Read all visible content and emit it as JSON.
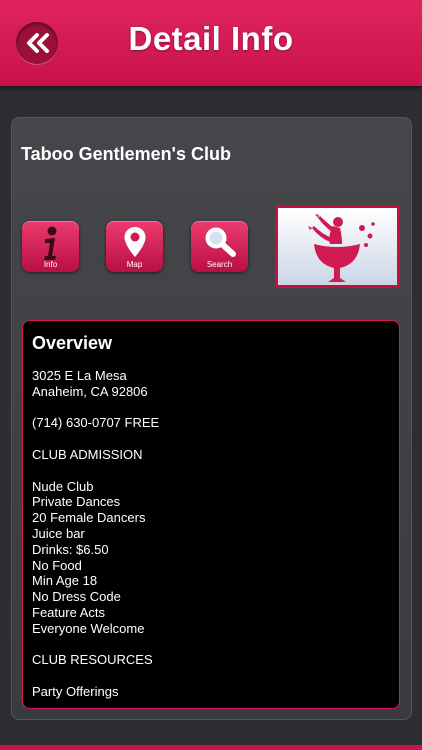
{
  "header": {
    "title": "Detail Info",
    "back_icon": "double-chevron-left-icon"
  },
  "club": {
    "name": "Taboo Gentlemen's Club"
  },
  "actions": [
    {
      "label": "Info",
      "icon": "info-icon"
    },
    {
      "label": "Map",
      "icon": "map-pin-icon"
    },
    {
      "label": "Search",
      "icon": "magnifier-icon"
    }
  ],
  "thumbnail": {
    "icon": "woman-in-wineglass-logo"
  },
  "overview": {
    "heading": "Overview",
    "lines": [
      "3025 E La Mesa",
      "Anaheim, CA 92806",
      "",
      "(714) 630-0707 FREE",
      "",
      "CLUB ADMISSION",
      "",
      "Nude Club",
      "Private Dances",
      "20 Female Dancers",
      "Juice bar",
      "Drinks: $6.50",
      "No Food",
      "Min Age 18",
      "No Dress Code",
      "Feature Acts",
      "Everyone Welcome",
      "",
      "CLUB RESOURCES",
      "",
      "Party Offerings"
    ]
  },
  "colors": {
    "accent": "#c8124c",
    "background": "#2d2e31",
    "panel": "#000000"
  }
}
